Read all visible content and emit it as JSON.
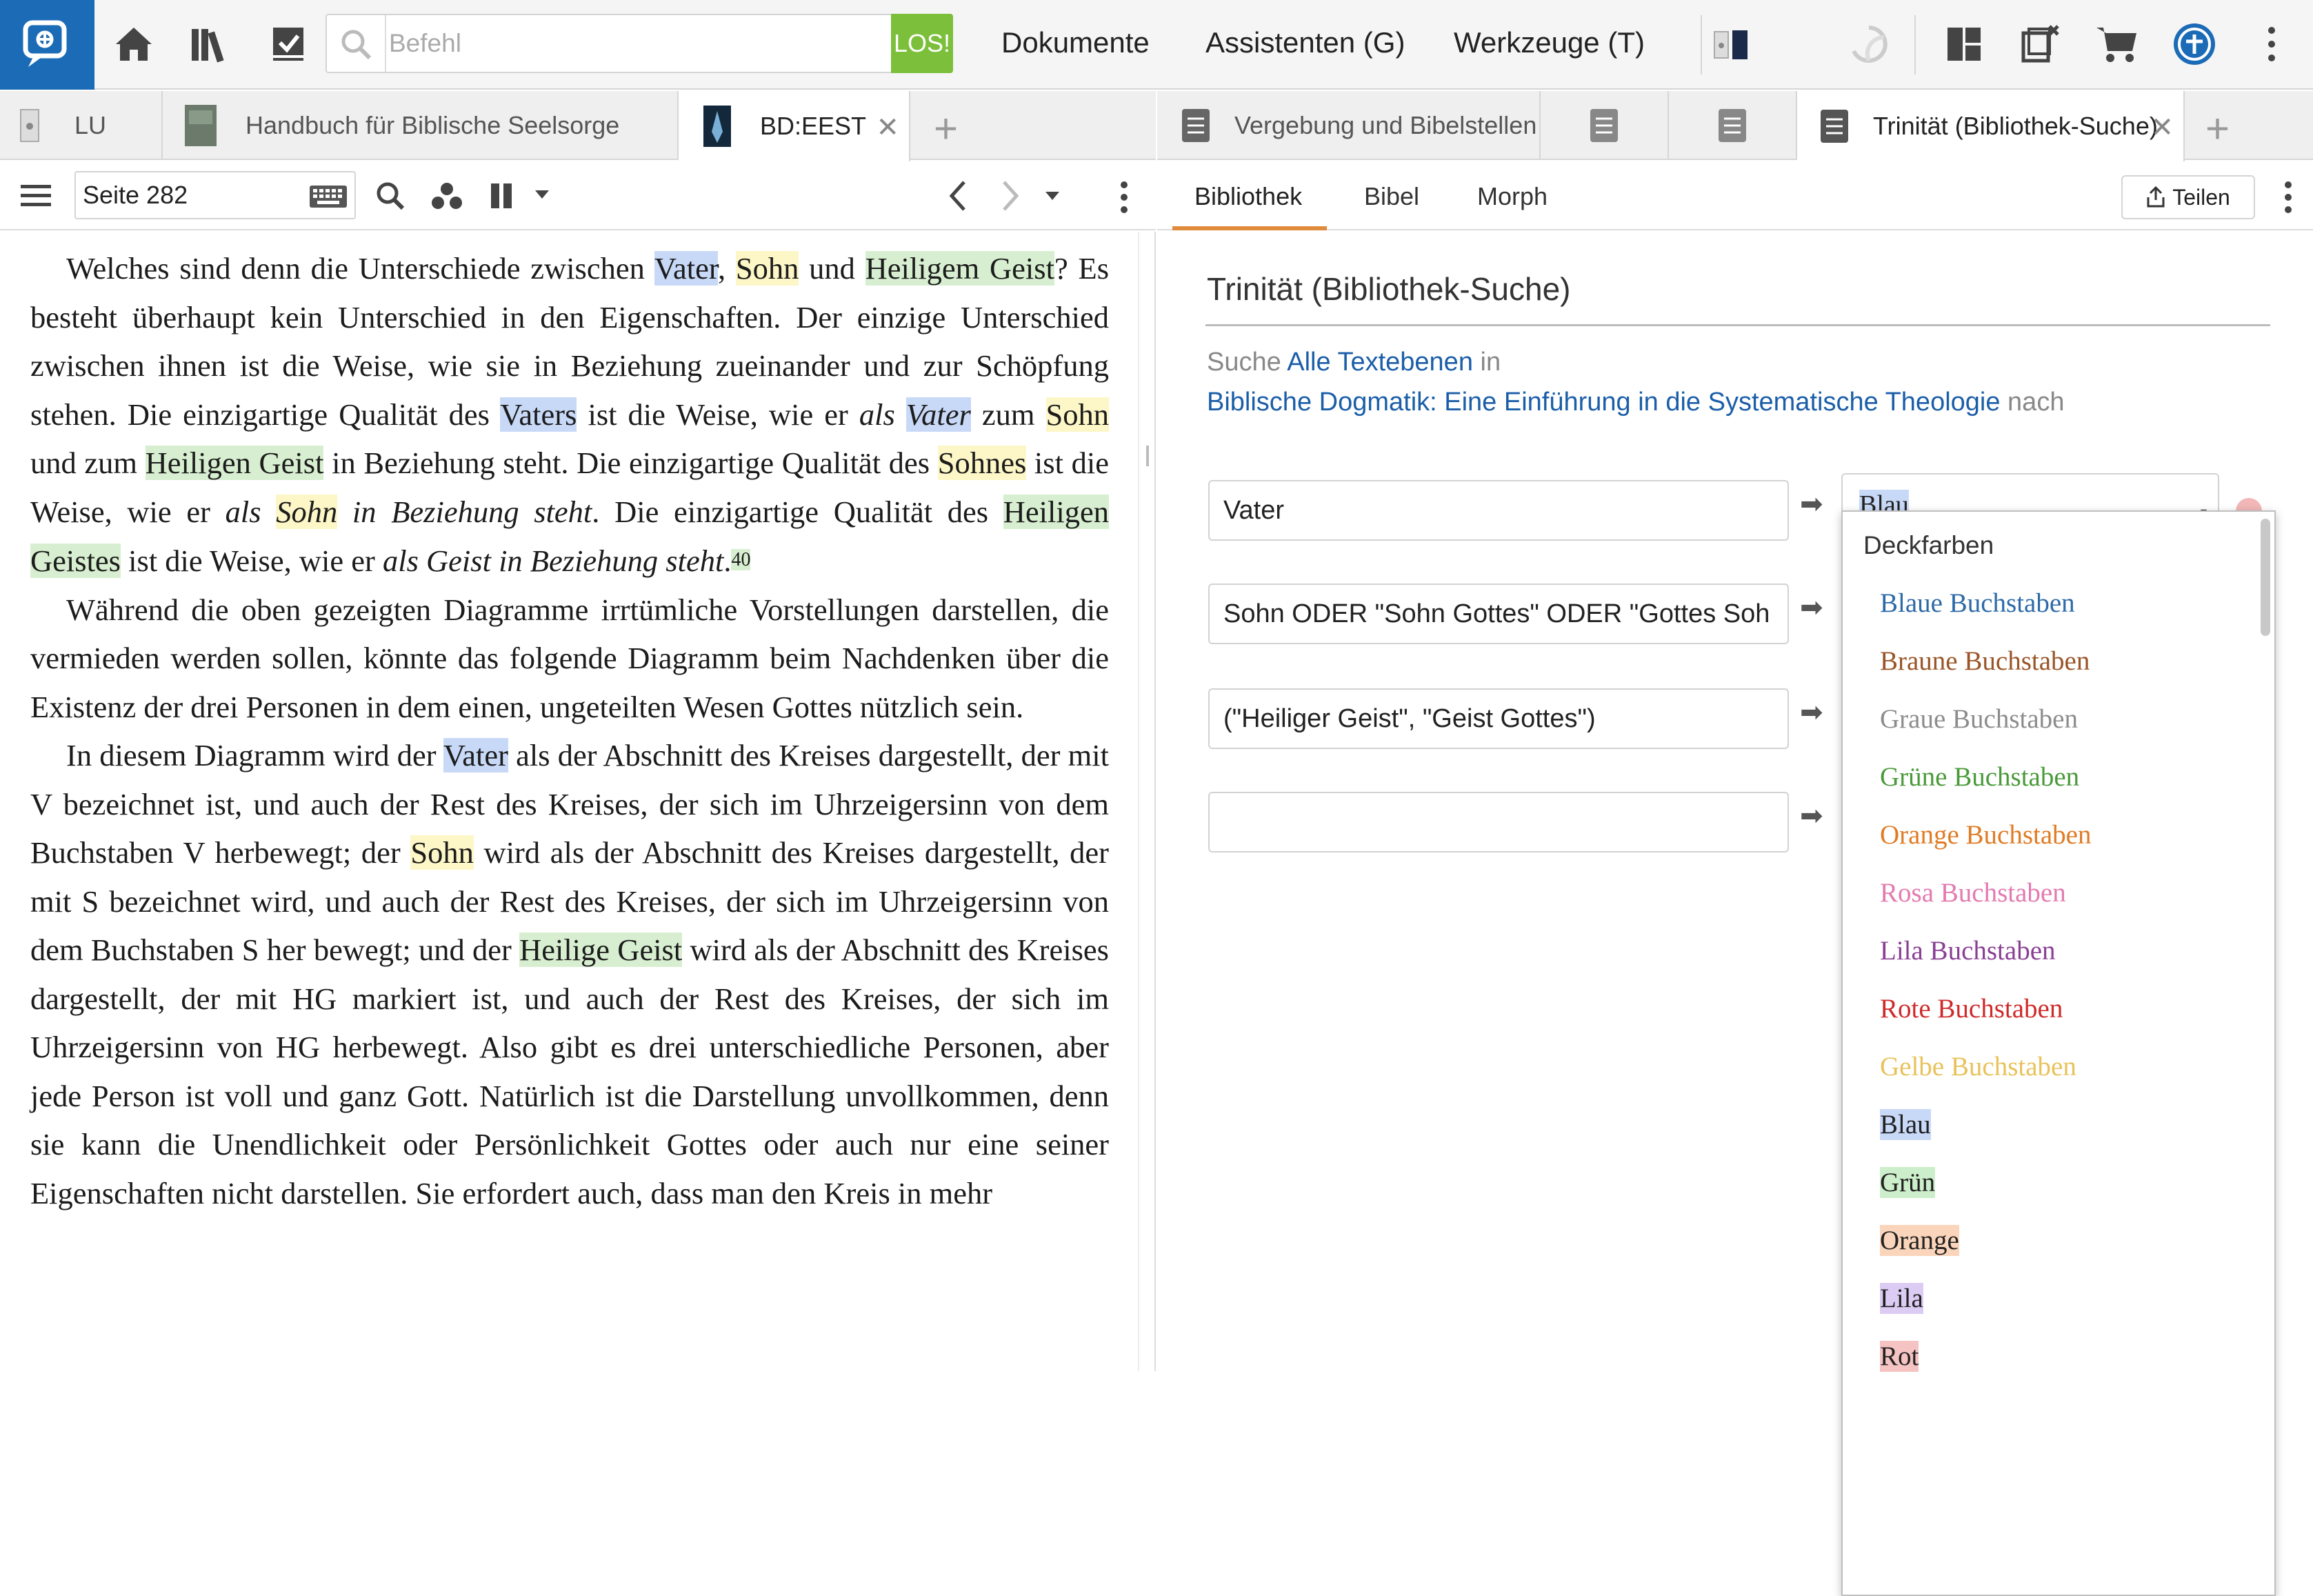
{
  "topbar": {
    "command_placeholder": "Befehl",
    "go_label": "LOS!",
    "menus": [
      "Dokumente",
      "Assistenten (G)",
      "Werkzeuge (T)"
    ]
  },
  "left_tabs": [
    {
      "label": "LU"
    },
    {
      "label": "Handbuch für Biblische Seelsorge"
    },
    {
      "label": "BD:EEST",
      "active": true
    }
  ],
  "right_tabs": [
    {
      "label": "Vergebung und Bibelstellen"
    },
    {
      "label": ""
    },
    {
      "label": ""
    },
    {
      "label": "Trinität (Bibliothek-Suche)",
      "active": true
    }
  ],
  "left_toolbar": {
    "page": "Seite 282"
  },
  "right_toolbar": {
    "tabs": [
      "Bibliothek",
      "Bibel",
      "Morph"
    ],
    "share_label": "Teilen"
  },
  "search_panel": {
    "title": "Trinität (Bibliothek-Suche)",
    "search_word": "Suche",
    "scope": "Alle Textebenen",
    "in_word": "in",
    "book": "Biblische Dogmatik: Eine Einführung in die Systematische Theologie",
    "nach_word": "nach",
    "fields": [
      "Vater",
      "Sohn ODER \"Sohn Gottes\" ODER \"Gottes Soh",
      "(\"Heiliger Geist\", \"Geist Gottes\")",
      ""
    ],
    "selected_color": "Blau"
  },
  "dropdown": {
    "header": "Deckfarben",
    "options": [
      {
        "label": "Blaue Buchstaben",
        "color": "#2d6aa8"
      },
      {
        "label": "Braune Buchstaben",
        "color": "#9a5426"
      },
      {
        "label": "Graue Buchstaben",
        "color": "#8c8c8c"
      },
      {
        "label": "Grüne Buchstaben",
        "color": "#4a9a3a"
      },
      {
        "label": "Orange Buchstaben",
        "color": "#e07b24"
      },
      {
        "label": "Rosa Buchstaben",
        "color": "#e37ab0"
      },
      {
        "label": "Lila Buchstaben",
        "color": "#8a3f94"
      },
      {
        "label": "Rote Buchstaben",
        "color": "#cf2a2a"
      },
      {
        "label": "Gelbe Buchstaben",
        "color": "#e8c25a"
      },
      {
        "label": "Blau",
        "bg": "#c8d9f8"
      },
      {
        "label": "Grün",
        "bg": "#cdeecb"
      },
      {
        "label": "Orange",
        "bg": "#fbd5bb"
      },
      {
        "label": "Lila",
        "bg": "#dcccf4"
      },
      {
        "label": "Rot",
        "bg": "#f6c3c3"
      }
    ]
  },
  "document": {
    "p1": [
      "Welches sind denn die Unterschiede zwischen ",
      "Vater",
      ", ",
      "Sohn",
      " und ",
      "Heiligem Geist",
      "? Es besteht überhaupt kein Unterschied in den Eigenschaften. Der einzige Unterschied zwischen ihnen ist die Weise, wie sie in Beziehung zueinander und zur Schöpfung stehen. Die einzigartige Qualität des ",
      "Vaters",
      " ist die Weise, wie er ",
      "als ",
      "Vater",
      " zum ",
      "Sohn",
      " und zum ",
      "Heiligen Geist",
      " in Beziehung steht. Die einzigartige Qualität des ",
      "Sohnes",
      " ist die Weise, wie er ",
      "als ",
      "Sohn",
      " in Beziehung steht",
      ". Die einzigartige Qualität des ",
      "Heiligen Geistes",
      " ist die Weise, wie er ",
      "als Geist in Beziehung steht",
      ".",
      "40"
    ],
    "p2": "Während die oben gezeigten Diagramme irrtümliche Vorstellungen darstellen, die vermieden werden sollen, könnte das folgende Diagramm beim Nachdenken über die Existenz der drei Personen in dem einen, ungeteilten Wesen Gottes nützlich sein.",
    "p3": [
      "In diesem Diagramm wird der ",
      "Vater",
      " als der Abschnitt des Kreises dargestellt, der mit V bezeichnet ist, und auch der Rest des Kreises, der sich im Uhrzeigersinn von dem Buchstaben V herbewegt; der ",
      "Sohn",
      " wird als der Abschnitt des Kreises dargestellt, der mit S bezeichnet wird, und auch der Rest des Kreises, der sich im Uhrzeigersinn von dem Buchstaben S her bewegt; und der ",
      "Heilige Geist",
      " wird als der Abschnitt des Kreises dargestellt, der mit HG markiert ist, und auch der Rest des Kreises, der sich im Uhrzeigersinn von HG herbewegt. Also gibt es drei unterschiedliche Personen, aber jede Person ist voll und ganz Gott. Natürlich ist die Darstellung unvollkommen, denn sie kann die Unendlichkeit oder Persönlichkeit Gottes oder auch nur eine seiner Eigenschaften nicht darstellen. Sie erfordert auch, dass man den Kreis in mehr"
    ]
  }
}
